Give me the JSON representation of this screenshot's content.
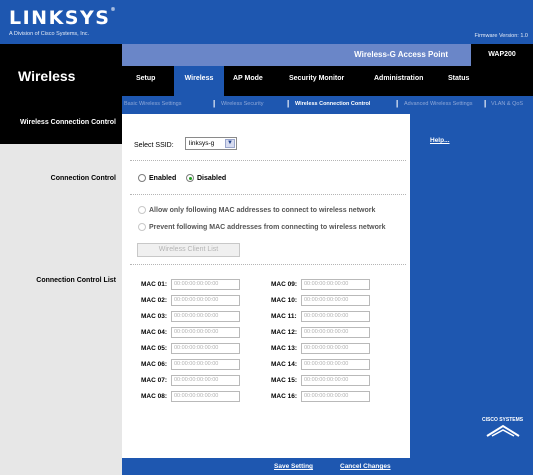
{
  "header": {
    "logo": "LINKSYS",
    "logo_mark": "®",
    "logo_sub": "A Division of Cisco Systems, Inc.",
    "firmware": "Firmware Version: 1.0"
  },
  "section_title": "Wireless",
  "product_name": "Wireless-G Access Point",
  "model": "WAP200",
  "tabs": [
    "Setup",
    "Wireless",
    "AP Mode",
    "Security Monitor",
    "Administration",
    "Status"
  ],
  "active_tab": "Wireless",
  "subtabs": [
    "Basic Wireless Settings",
    "Wireless Security",
    "Wireless Connection Control",
    "Advanced Wireless Settings",
    "VLAN & QoS"
  ],
  "page_heading": "Wireless Connection Control",
  "left_labels": {
    "connection_control": "Connection Control",
    "connection_control_list": "Connection Control List"
  },
  "ssid": {
    "label": "Select SSID:",
    "value": "linksys-g"
  },
  "connection_control": {
    "enabled": "Enabled",
    "disabled": "Disabled",
    "selected": "Disabled"
  },
  "mac_policy": {
    "allow": "Allow only following MAC addresses to connect to wireless network",
    "prevent": "Prevent following MAC addresses from connecting to wireless network"
  },
  "client_list_button": "Wireless Client List",
  "mac_placeholder": "00:00:00:00:00:00",
  "mac_left": [
    {
      "label": "MAC 01:",
      "value": "00:00:00:00:00:00"
    },
    {
      "label": "MAC 02:",
      "value": "00:00:00:00:00:00"
    },
    {
      "label": "MAC 03:",
      "value": "00:00:00:00:00:00"
    },
    {
      "label": "MAC 04:",
      "value": "00:00:00:00:00:00"
    },
    {
      "label": "MAC 05:",
      "value": "00:00:00:00:00:00"
    },
    {
      "label": "MAC 06:",
      "value": "00:00:00:00:00:00"
    },
    {
      "label": "MAC 07:",
      "value": "00:00:00:00:00:00"
    },
    {
      "label": "MAC 08:",
      "value": "00:00:00:00:00:00"
    }
  ],
  "mac_right": [
    {
      "label": "MAC 09:",
      "value": "00:00:00:00:00:00"
    },
    {
      "label": "MAC 10:",
      "value": "00:00:00:00:00:00"
    },
    {
      "label": "MAC 11:",
      "value": "00:00:00:00:00:00"
    },
    {
      "label": "MAC 12:",
      "value": "00:00:00:00:00:00"
    },
    {
      "label": "MAC 13:",
      "value": "00:00:00:00:00:00"
    },
    {
      "label": "MAC 14:",
      "value": "00:00:00:00:00:00"
    },
    {
      "label": "MAC 15:",
      "value": "00:00:00:00:00:00"
    },
    {
      "label": "MAC 16:",
      "value": "00:00:00:00:00:00"
    }
  ],
  "help_link": "Help...",
  "brand_footer": "CISCO SYSTEMS",
  "footer": {
    "save": "Save Setting",
    "cancel": "Cancel Changes"
  },
  "colors": {
    "brand_blue": "#1e57b0",
    "band": "#000000",
    "model_bar": "#6a86c8",
    "radio_selected": "#1f9d1f"
  }
}
